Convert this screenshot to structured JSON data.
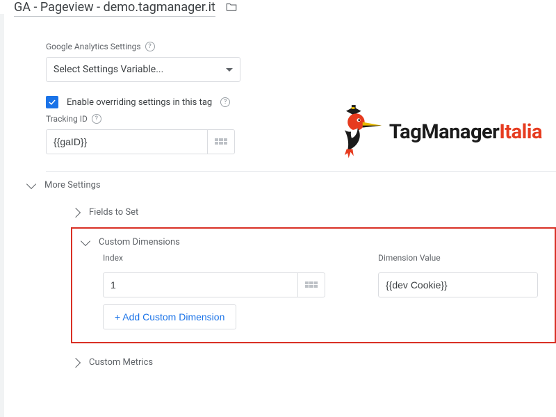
{
  "title": "GA - Pageview - demo.tagmanager.it",
  "settings": {
    "label": "Google Analytics Settings",
    "selectPlaceholder": "Select Settings Variable..."
  },
  "override": {
    "checkboxLabel": "Enable overriding settings in this tag"
  },
  "tracking": {
    "label": "Tracking ID",
    "value": "{{gaID}}"
  },
  "more": {
    "label": "More Settings",
    "fieldsToSet": "Fields to Set",
    "customDimensions": {
      "label": "Custom Dimensions",
      "indexHeader": "Index",
      "valueHeader": "Dimension Value",
      "rows": [
        {
          "index": "1",
          "value": "{{dev Cookie}}"
        }
      ],
      "addLabel": "+ Add Custom Dimension"
    },
    "customMetrics": "Custom Metrics"
  },
  "logo": {
    "part1": "TagManager",
    "part2": "Italia"
  }
}
